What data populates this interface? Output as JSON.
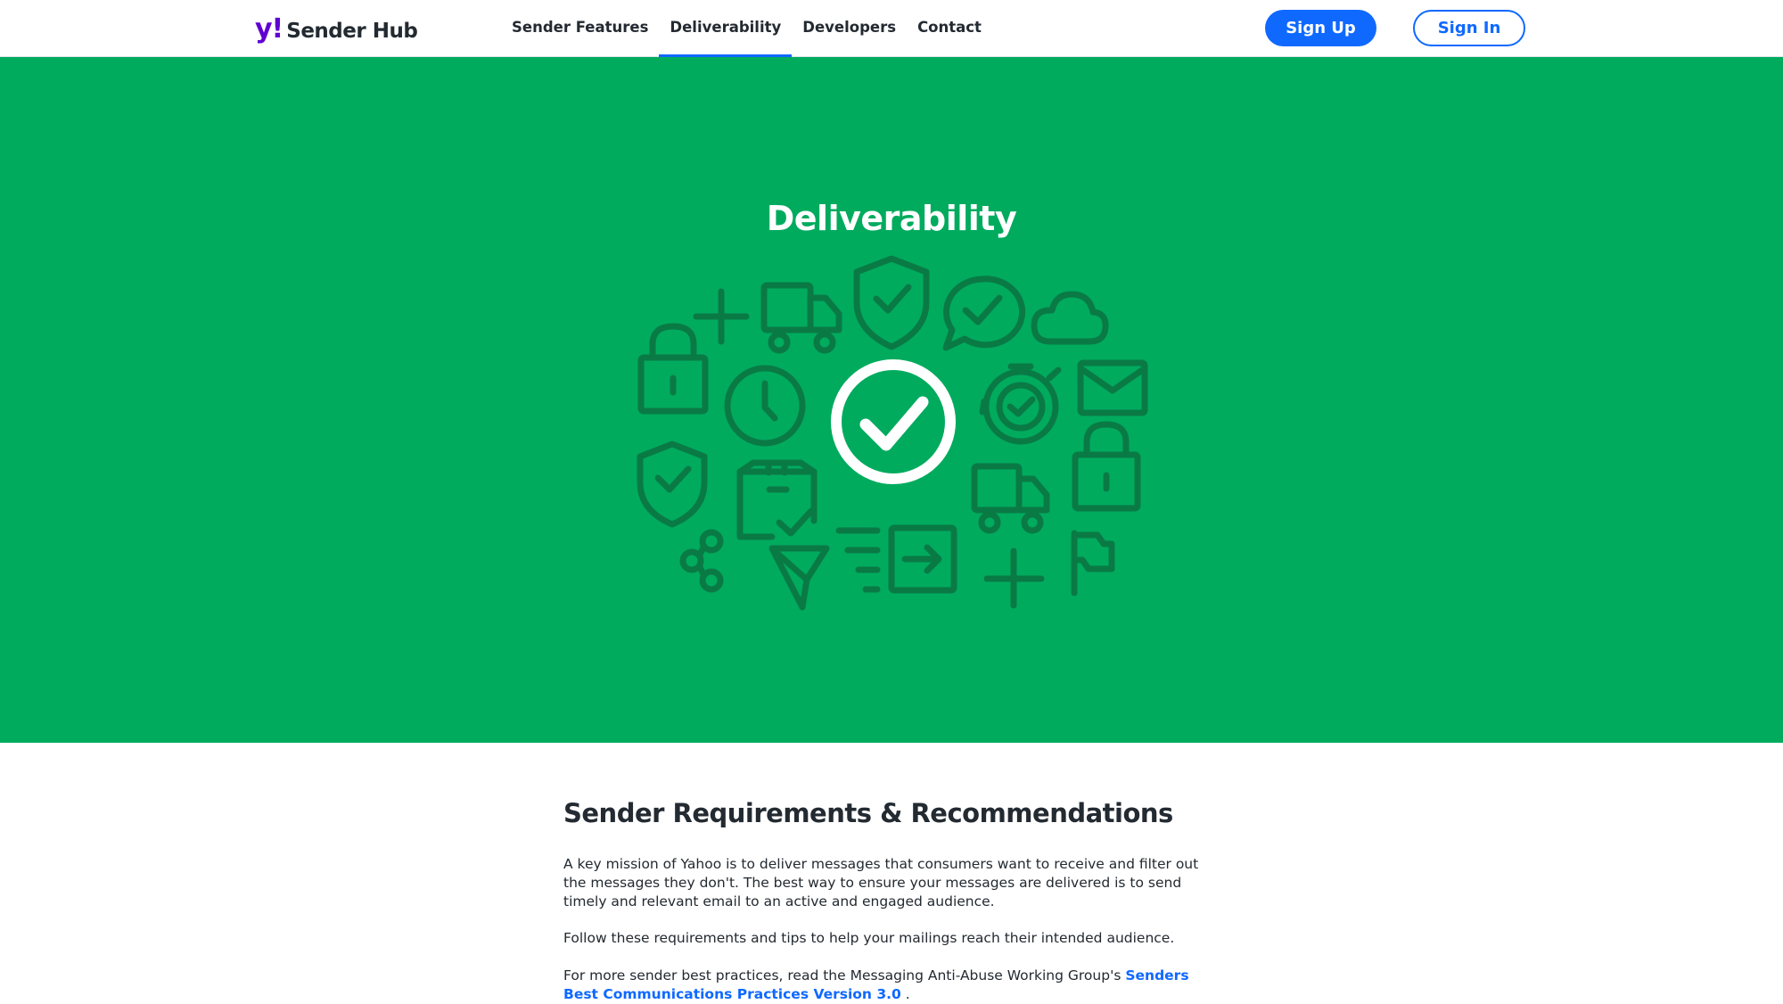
{
  "header": {
    "logo_mark": "y!",
    "logo_text": "Sender Hub",
    "nav": [
      {
        "label": "Sender Features",
        "active": false
      },
      {
        "label": "Deliverability",
        "active": true
      },
      {
        "label": "Developers",
        "active": false
      },
      {
        "label": "Contact",
        "active": false
      }
    ],
    "signup_label": "Sign Up",
    "signin_label": "Sign In"
  },
  "hero": {
    "title": "Deliverability",
    "background_color": "#00ab5e",
    "icon_color": "#0a7a45",
    "icons": [
      "plus-icon",
      "truck-icon",
      "shield-check-icon",
      "chat-check-icon",
      "cloud-icon",
      "lock-icon",
      "clock-icon",
      "check-circle-icon",
      "stopwatch-check-icon",
      "mail-icon",
      "shield-check-icon",
      "package-check-icon",
      "truck-icon",
      "lock-icon",
      "share-icon",
      "send-icon",
      "list-icon",
      "export-icon",
      "plus-icon",
      "flag-icon"
    ]
  },
  "main": {
    "heading": "Sender Requirements & Recommendations",
    "p1": "A key mission of Yahoo is to deliver messages that consumers want to receive and filter out the messages they don't. The best way to ensure your messages are delivered is to send timely and relevant email to an active and engaged audience.",
    "p2": "Follow these requirements and tips to help your mailings reach their intended audience.",
    "p3_text": "For more sender best practices, read the Messaging Anti-Abuse Working Group's ",
    "p3_link": "Senders Best Communications Practices Version 3.0",
    "p3_end": " ."
  },
  "colors": {
    "accent": "#0f69ff",
    "brand": "#6001d2",
    "text": "#232a31"
  }
}
